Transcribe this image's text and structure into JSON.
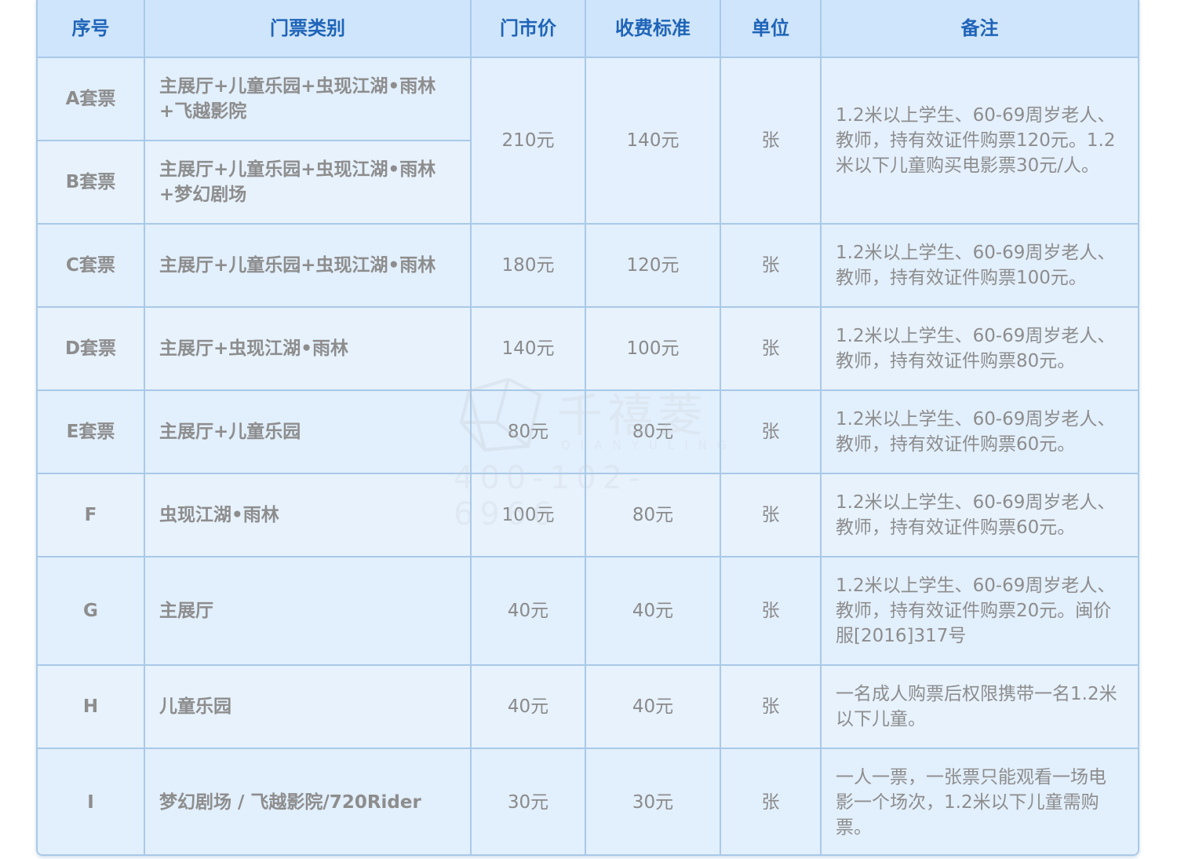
{
  "headers": [
    "序号",
    "门票类别",
    "门市价",
    "收费标准",
    "单位",
    "备注"
  ],
  "rows": {
    "A": {
      "seq": "A套票",
      "cat": "主展厅+儿童乐园+虫现江湖•雨林+飞越影院"
    },
    "B": {
      "seq": "B套票",
      "cat": "主展厅+儿童乐园+虫现江湖•雨林+梦幻剧场"
    },
    "AB": {
      "price": "210元",
      "fee": "140元",
      "unit": "张",
      "note": "1.2米以上学生、60-69周岁老人、教师，持有效证件购票120元。1.2米以下儿童购买电影票30元/人。"
    },
    "C": {
      "seq": "C套票",
      "cat": "主展厅+儿童乐园+虫现江湖•雨林",
      "price": "180元",
      "fee": "120元",
      "unit": "张",
      "note": "1.2米以上学生、60-69周岁老人、教师，持有效证件购票100元。"
    },
    "D": {
      "seq": "D套票",
      "cat": "主展厅+虫现江湖•雨林",
      "price": "140元",
      "fee": "100元",
      "unit": "张",
      "note": "1.2米以上学生、60-69周岁老人、教师，持有效证件购票80元。"
    },
    "E": {
      "seq": "E套票",
      "cat": "主展厅+儿童乐园",
      "price": "80元",
      "fee": "80元",
      "unit": "张",
      "note": "1.2米以上学生、60-69周岁老人、教师，持有效证件购票60元。"
    },
    "F": {
      "seq": "F",
      "cat": "虫现江湖•雨林",
      "price": "100元",
      "fee": "80元",
      "unit": "张",
      "note": "1.2米以上学生、60-69周岁老人、教师，持有效证件购票60元。"
    },
    "G": {
      "seq": "G",
      "cat": "主展厅",
      "price": "40元",
      "fee": "40元",
      "unit": "张",
      "note": "1.2米以上学生、60-69周岁老人、教师，持有效证件购票20元。闽价服[2016]317号"
    },
    "H": {
      "seq": "H",
      "cat": "儿童乐园",
      "price": "40元",
      "fee": "40元",
      "unit": "张",
      "note": "一名成人购票后权限携带一名1.2米以下儿童。"
    },
    "I": {
      "seq": "I",
      "cat": "梦幻剧场 / 飞越影院/720Rider",
      "price": "30元",
      "fee": "30元",
      "unit": "张",
      "note": "一人一票，一张票只能观看一场电影一个场次，1.2米以下儿童需购票。"
    }
  },
  "watermark": {
    "brand": "千禧菱",
    "pinyin": "QIANYULING",
    "phone": "400-102-6966"
  }
}
